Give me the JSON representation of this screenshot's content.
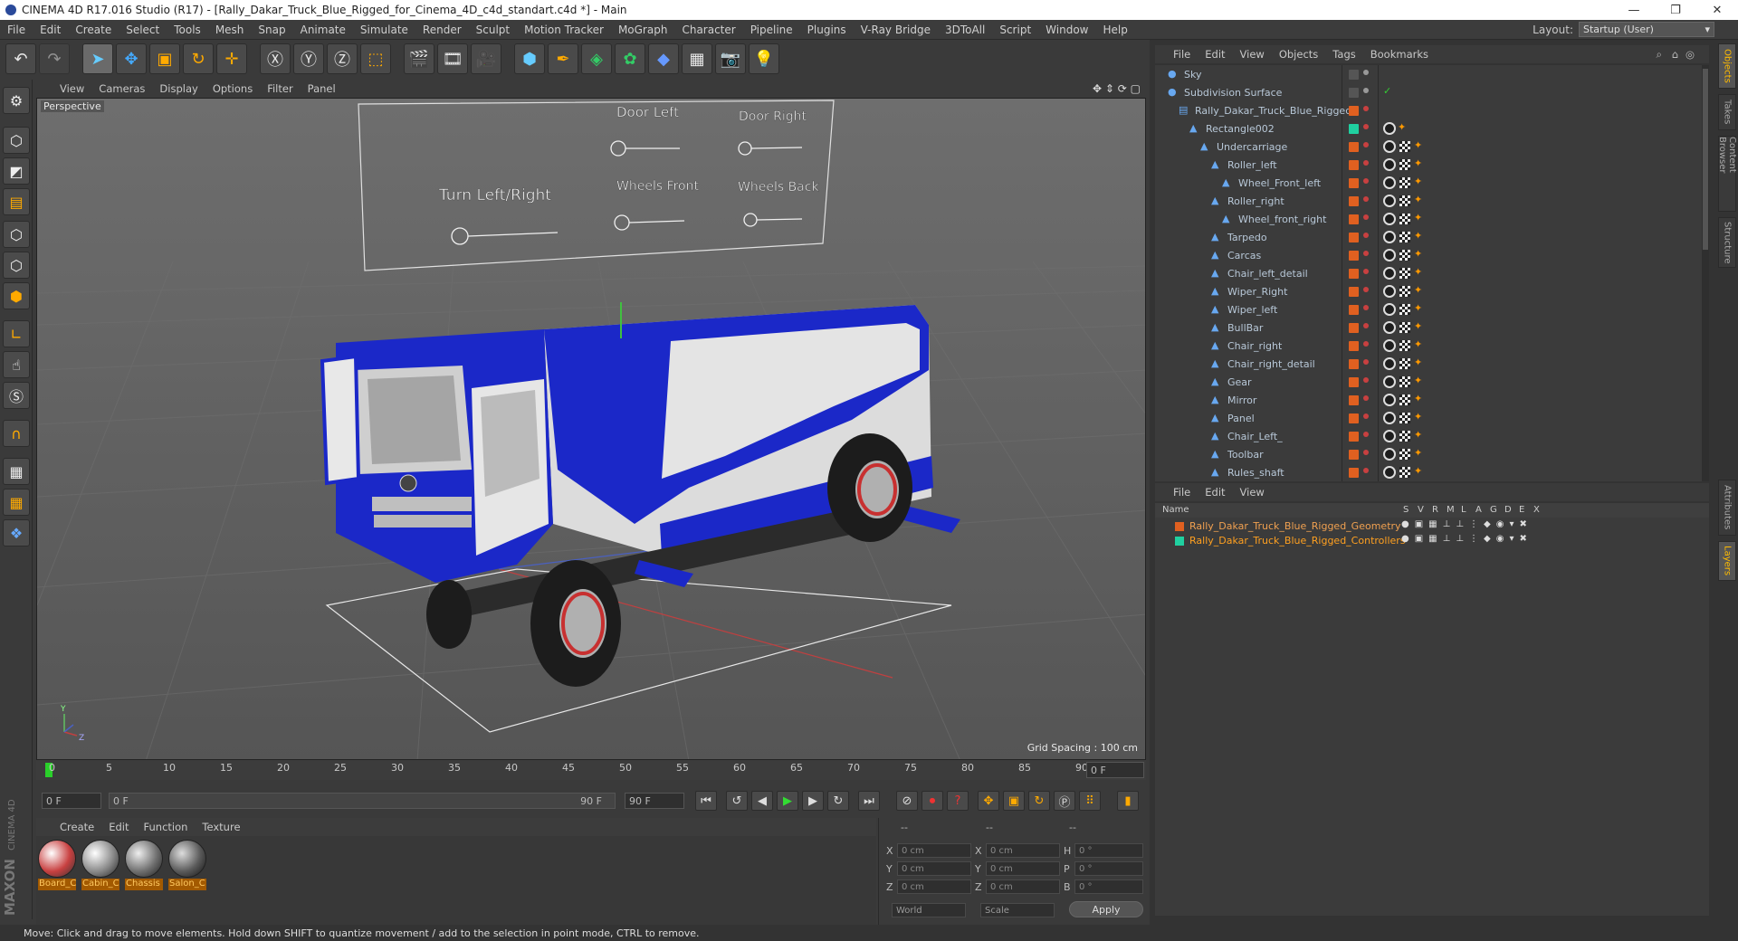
{
  "window": {
    "title": "CINEMA 4D R17.016 Studio (R17) - [Rally_Dakar_Truck_Blue_Rigged_for_Cinema_4D_c4d_standart.c4d *] - Main",
    "controls": [
      "—",
      "❐",
      "✕"
    ]
  },
  "menubar": {
    "items": [
      "File",
      "Edit",
      "Create",
      "Select",
      "Tools",
      "Mesh",
      "Snap",
      "Animate",
      "Simulate",
      "Render",
      "Sculpt",
      "Motion Tracker",
      "MoGraph",
      "Character",
      "Pipeline",
      "Plugins",
      "V-Ray Bridge",
      "3DToAll",
      "Script",
      "Window",
      "Help"
    ],
    "layout_label": "Layout:",
    "layout_value": "Startup (User)"
  },
  "viewport": {
    "menu": [
      "View",
      "Cameras",
      "Display",
      "Options",
      "Filter",
      "Panel"
    ],
    "camera_label": "Perspective",
    "grid_spacing": "Grid Spacing : 100 cm",
    "controller_labels": {
      "door_left": "Door Left",
      "door_right": "Door Right",
      "turn": "Turn  Left/Right",
      "wheels_front": "Wheels Front",
      "wheels_back": "Wheels Back"
    },
    "axis": {
      "y": "Y",
      "z": "Z"
    }
  },
  "timeline": {
    "ticks": [
      "0",
      "5",
      "10",
      "15",
      "20",
      "25",
      "30",
      "35",
      "40",
      "45",
      "50",
      "55",
      "60",
      "65",
      "70",
      "75",
      "80",
      "85",
      "90"
    ],
    "end_field": "0 F",
    "current": "0 F",
    "range_start": "0 F",
    "range_end": "90 F",
    "max": "90 F"
  },
  "materials": {
    "menu": [
      "Create",
      "Edit",
      "Function",
      "Texture"
    ],
    "items": [
      {
        "name": "Board_C",
        "color": "#c84040"
      },
      {
        "name": "Cabin_C",
        "color": "#8a8a8a"
      },
      {
        "name": "Chassis",
        "color": "#707070"
      },
      {
        "name": "Salon_C",
        "color": "#5a5a5a"
      }
    ],
    "brand_top": "MAXON",
    "brand_bottom": "CINEMA 4D"
  },
  "coordinates": {
    "headers": [
      "--",
      "--",
      "--"
    ],
    "rows": [
      {
        "a": "X",
        "av": "0 cm",
        "b": "X",
        "bv": "0 cm",
        "c": "H",
        "cv": "0 °"
      },
      {
        "a": "Y",
        "av": "0 cm",
        "b": "Y",
        "bv": "0 cm",
        "c": "P",
        "cv": "0 °"
      },
      {
        "a": "Z",
        "av": "0 cm",
        "b": "Z",
        "bv": "0 cm",
        "c": "B",
        "cv": "0 °"
      }
    ],
    "world": "World",
    "scale": "Scale",
    "apply": "Apply"
  },
  "status": "Move: Click and drag to move elements. Hold down SHIFT to quantize movement / add to the selection in point mode, CTRL to remove.",
  "object_manager": {
    "menu": [
      "File",
      "Edit",
      "View",
      "Objects",
      "Tags",
      "Bookmarks"
    ],
    "objects": [
      {
        "name": "Sky",
        "indent": 0,
        "color": "#555"
      },
      {
        "name": "Subdivision Surface",
        "indent": 0,
        "color": "#555"
      },
      {
        "name": "Rally_Dakar_Truck_Blue_Rigged",
        "indent": 1,
        "color": "#e06020"
      },
      {
        "name": "Rectangle002",
        "indent": 2,
        "color": "#20d0a0"
      },
      {
        "name": "Undercarriage",
        "indent": 3,
        "color": "#e06020"
      },
      {
        "name": "Roller_left",
        "indent": 4,
        "color": "#e06020"
      },
      {
        "name": "Wheel_Front_left",
        "indent": 5,
        "color": "#e06020"
      },
      {
        "name": "Roller_right",
        "indent": 4,
        "color": "#e06020"
      },
      {
        "name": "Wheel_front_right",
        "indent": 5,
        "color": "#e06020"
      },
      {
        "name": "Tarpedo",
        "indent": 4,
        "color": "#e06020"
      },
      {
        "name": "Carcas",
        "indent": 4,
        "color": "#e06020"
      },
      {
        "name": "Chair_left_detail",
        "indent": 4,
        "color": "#e06020"
      },
      {
        "name": "Wiper_Right",
        "indent": 4,
        "color": "#e06020"
      },
      {
        "name": "Wiper_left",
        "indent": 4,
        "color": "#e06020"
      },
      {
        "name": "BullBar",
        "indent": 4,
        "color": "#e06020"
      },
      {
        "name": "Chair_right",
        "indent": 4,
        "color": "#e06020"
      },
      {
        "name": "Chair_right_detail",
        "indent": 4,
        "color": "#e06020"
      },
      {
        "name": "Gear",
        "indent": 4,
        "color": "#e06020"
      },
      {
        "name": "Mirror",
        "indent": 4,
        "color": "#e06020"
      },
      {
        "name": "Panel",
        "indent": 4,
        "color": "#e06020"
      },
      {
        "name": "Chair_Left_",
        "indent": 4,
        "color": "#e06020"
      },
      {
        "name": "Toolbar",
        "indent": 4,
        "color": "#e06020"
      },
      {
        "name": "Rules_shaft",
        "indent": 4,
        "color": "#e06020"
      }
    ]
  },
  "layer_manager": {
    "menu": [
      "File",
      "Edit",
      "View"
    ],
    "columns": [
      "Name",
      "S",
      "V",
      "R",
      "M",
      "L",
      "A",
      "G",
      "D",
      "E",
      "X"
    ],
    "layers": [
      {
        "name": "Rally_Dakar_Truck_Blue_Rigged_Geometry",
        "color": "#e06020"
      },
      {
        "name": "Rally_Dakar_Truck_Blue_Rigged_Controllers",
        "color": "#20d0a0"
      }
    ]
  },
  "side_tabs": [
    "Objects",
    "Takes",
    "Content Browser",
    "Structure",
    "Attributes",
    "Layers"
  ]
}
